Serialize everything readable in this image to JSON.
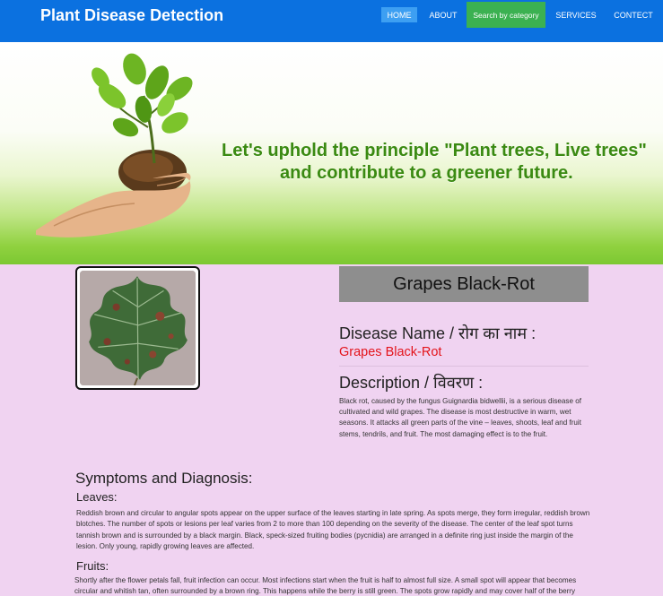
{
  "navbar": {
    "brand": "Plant Disease Detection",
    "items": [
      {
        "label": "HOME"
      },
      {
        "label": "ABOUT"
      },
      {
        "label": "Search by category"
      },
      {
        "label": "SERVICES"
      },
      {
        "label": "CONTECT"
      }
    ],
    "color": "#0b71e0",
    "active_color": "#3d9ff2",
    "highlight_color": "#3bb151"
  },
  "banner": {
    "line1": "Let's uphold the principle \"Plant trees, Live trees\"",
    "line2": "and contribute to a greener future."
  },
  "disease": {
    "title": "Grapes Black-Rot",
    "name_heading": "Disease Name / रोग का नाम :",
    "name_value": "Grapes Black-Rot",
    "description_heading": "Description / विवरण :",
    "description": "Black rot, caused by the fungus Guignardia bidwellii, is a serious disease of cultivated and wild grapes. The disease is most destructive in warm, wet seasons. It attacks all green parts of the vine – leaves, shoots, leaf and fruit stems, tendrils, and fruit. The most damaging effect is to the fruit."
  },
  "symptoms": {
    "heading": "Symptoms and Diagnosis:",
    "leaves_heading": "Leaves:",
    "leaves_text": "Reddish brown and circular to angular spots appear on the upper surface of the leaves starting in late spring. As spots merge, they form irregular, reddish brown blotches. The number of spots or lesions per leaf varies from 2 to more than 100 depending on the severity of the disease. The center of the leaf spot turns tannish brown and is surrounded by a black margin. Black, speck-sized fruiting bodies (pycnidia) are arranged in a definite ring just inside the margin of the lesion. Only young, rapidly growing leaves are affected.",
    "fruits_heading": "Fruits:",
    "fruits_text": "Shortly after the flower petals fall, fruit infection can occur. Most infections start when the fruit is half to almost full size. A small spot will appear that becomes circular and whitish tan, often surrounded by a brown ring. This happens while the berry is still green. The spots grow rapidly and may cover half of the berry"
  }
}
